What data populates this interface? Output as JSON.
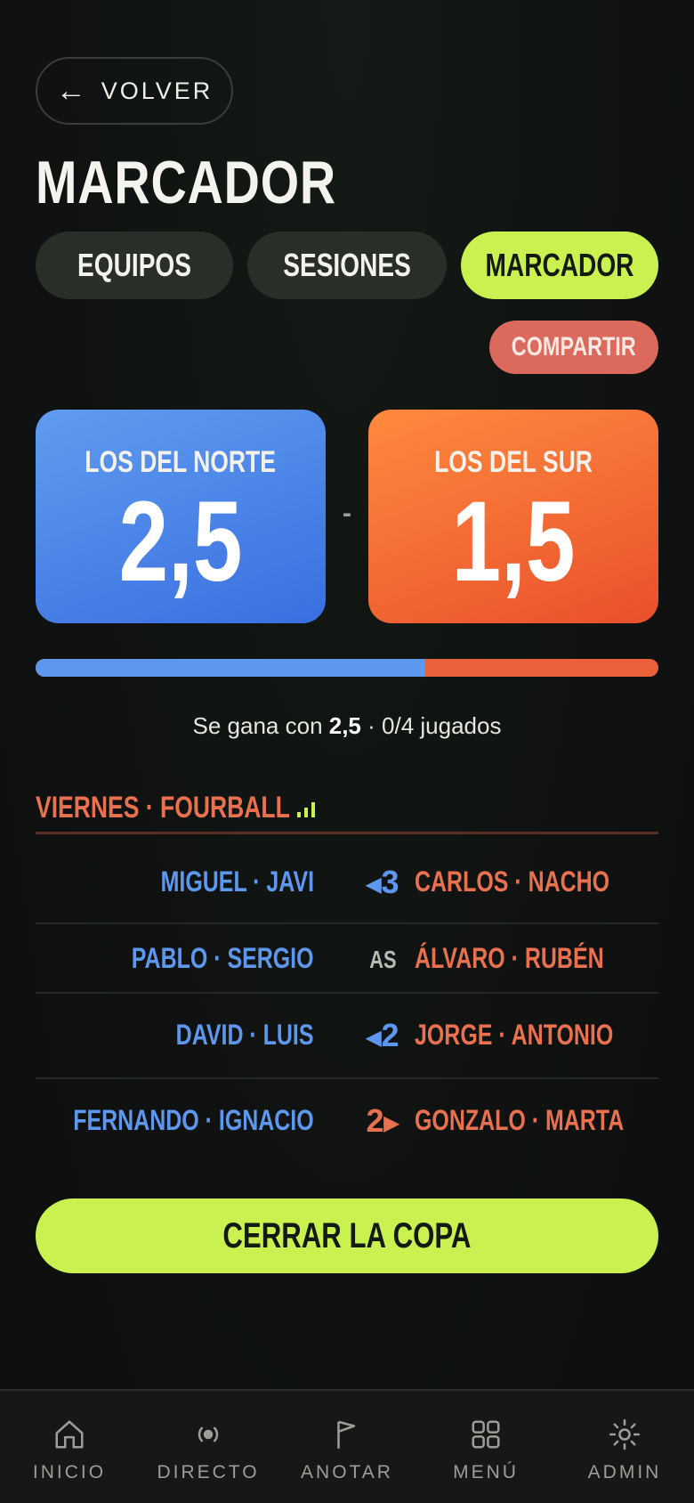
{
  "header": {
    "back_label": "VOLVER",
    "title": "MARCADOR"
  },
  "tabs": [
    {
      "label": "EQUIPOS",
      "active": false
    },
    {
      "label": "SESIONES",
      "active": false
    },
    {
      "label": "MARCADOR",
      "active": true
    }
  ],
  "share_label": "COMPARTIR",
  "scoreboard": {
    "team_a": {
      "name": "LOS DEL NORTE",
      "score": "2,5",
      "color": "#4a82e8"
    },
    "separator": "-",
    "team_b": {
      "name": "LOS DEL SUR",
      "score": "1,5",
      "color": "#ef6a34"
    },
    "progress_team_a_fraction": 0.625
  },
  "status": {
    "prefix": "Se gana con ",
    "target": "2,5",
    "suffix": " · 0/4 jugados"
  },
  "session": {
    "title": "VIERNES · FOURBALL",
    "matches": [
      {
        "left": "MIGUEL · JAVI",
        "result": "3",
        "leader": "left",
        "right": "CARLOS · NACHO"
      },
      {
        "left": "PABLO · SERGIO",
        "result": "AS",
        "leader": "none",
        "right": "ÁLVARO · RUBÉN"
      },
      {
        "left": "DAVID · LUIS",
        "result": "2",
        "leader": "left",
        "right": "JORGE · ANTONIO"
      },
      {
        "left": "FERNANDO · IGNACIO",
        "result": "2",
        "leader": "right",
        "right": "GONZALO · MARTA"
      }
    ]
  },
  "close_label": "CERRAR LA COPA",
  "nav": [
    {
      "label": "INICIO",
      "icon": "home-icon"
    },
    {
      "label": "DIRECTO",
      "icon": "live-icon"
    },
    {
      "label": "ANOTAR",
      "icon": "flag-icon"
    },
    {
      "label": "MENÚ",
      "icon": "grid-icon"
    },
    {
      "label": "ADMIN",
      "icon": "gear-icon"
    }
  ],
  "colors": {
    "accent": "#c9f150",
    "blue": "#5e98ee",
    "orange": "#e9714f",
    "share": "#db6a5c"
  }
}
